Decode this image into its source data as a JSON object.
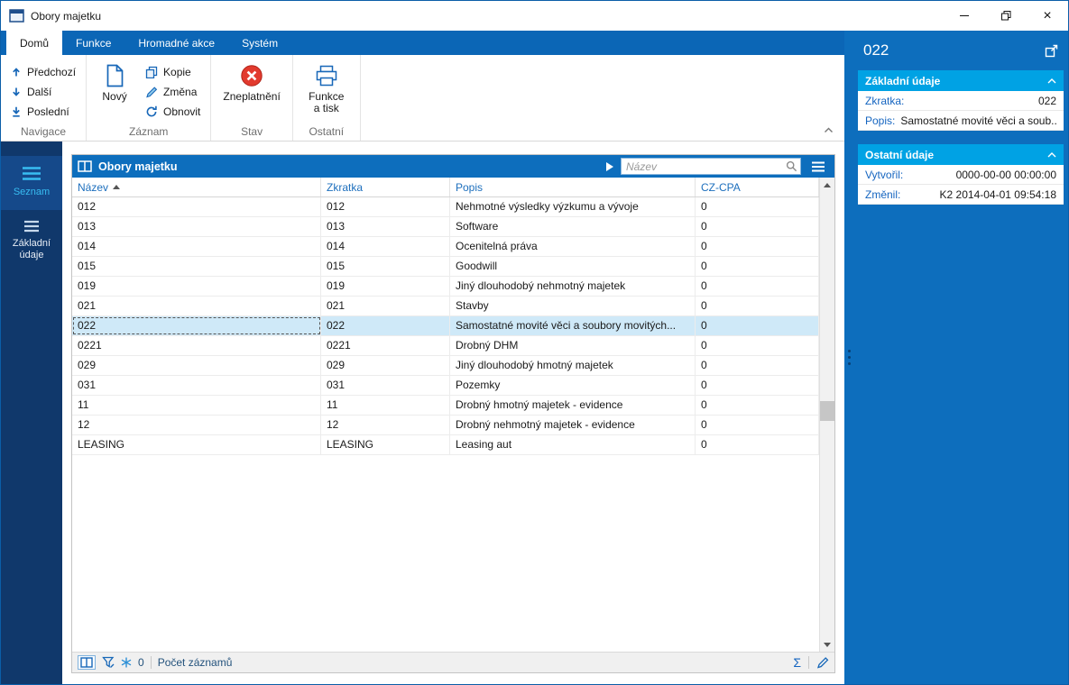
{
  "window": {
    "title": "Obory majetku"
  },
  "ribbon": {
    "tabs": [
      {
        "label": "Domů",
        "active": true
      },
      {
        "label": "Funkce",
        "active": false
      },
      {
        "label": "Hromadné akce",
        "active": false
      },
      {
        "label": "Systém",
        "active": false
      }
    ],
    "groups": {
      "navigace": {
        "label": "Navigace",
        "items": [
          "Předchozí",
          "Další",
          "Poslední"
        ]
      },
      "zaznam": {
        "label": "Záznam",
        "big_button": "Nový",
        "items": [
          "Kopie",
          "Změna",
          "Obnovit"
        ]
      },
      "stav": {
        "label": "Stav",
        "big_button": "Zneplatnění"
      },
      "ostatni": {
        "label": "Ostatní",
        "big_button": "Funkce a tisk"
      }
    }
  },
  "sidebar": {
    "items": [
      {
        "label": "Seznam",
        "active": true
      },
      {
        "label": "Základní údaje",
        "active": false
      }
    ]
  },
  "table_panel": {
    "title": "Obory majetku",
    "search": {
      "placeholder": "Název"
    },
    "columns": [
      "Název",
      "Zkratka",
      "Popis",
      "CZ-CPA"
    ],
    "sorted_by": "Název",
    "rows": [
      [
        "012",
        "012",
        "Nehmotné výsledky výzkumu a vývoje",
        "0"
      ],
      [
        "013",
        "013",
        "Software",
        "0"
      ],
      [
        "014",
        "014",
        "Ocenitelná práva",
        "0"
      ],
      [
        "015",
        "015",
        "Goodwill",
        "0"
      ],
      [
        "019",
        "019",
        "Jiný dlouhodobý nehmotný majetek",
        "0"
      ],
      [
        "021",
        "021",
        "Stavby",
        "0"
      ],
      [
        "022",
        "022",
        "Samostatné movité věci a soubory movitých...",
        "0"
      ],
      [
        "0221",
        "0221",
        "Drobný DHM",
        "0"
      ],
      [
        "029",
        "029",
        "Jiný dlouhodobý hmotný majetek",
        "0"
      ],
      [
        "031",
        "031",
        "Pozemky",
        "0"
      ],
      [
        "11",
        "11",
        "Drobný hmotný majetek - evidence",
        "0"
      ],
      [
        "12",
        "12",
        "Drobný nehmotný majetek - evidence",
        "0"
      ],
      [
        "LEASING",
        "LEASING",
        "Leasing aut",
        "0"
      ]
    ],
    "selected_row_index": 6,
    "statusbar": {
      "frozen_count": "0",
      "count_label": "Počet záznamů",
      "sum_symbol": "Σ"
    }
  },
  "detail_panel": {
    "title": "022",
    "sections": [
      {
        "title": "Základní údaje",
        "fields": [
          {
            "label": "Zkratka:",
            "value": "022"
          },
          {
            "label": "Popis:",
            "value": "Samostatné movité věci a soub..."
          }
        ]
      },
      {
        "title": "Ostatní údaje",
        "fields": [
          {
            "label": "Vytvořil:",
            "value": "0000-00-00 00:00:00"
          },
          {
            "label": "Změnil:",
            "value": "K2 2014-04-01 09:54:18"
          }
        ]
      }
    ]
  }
}
